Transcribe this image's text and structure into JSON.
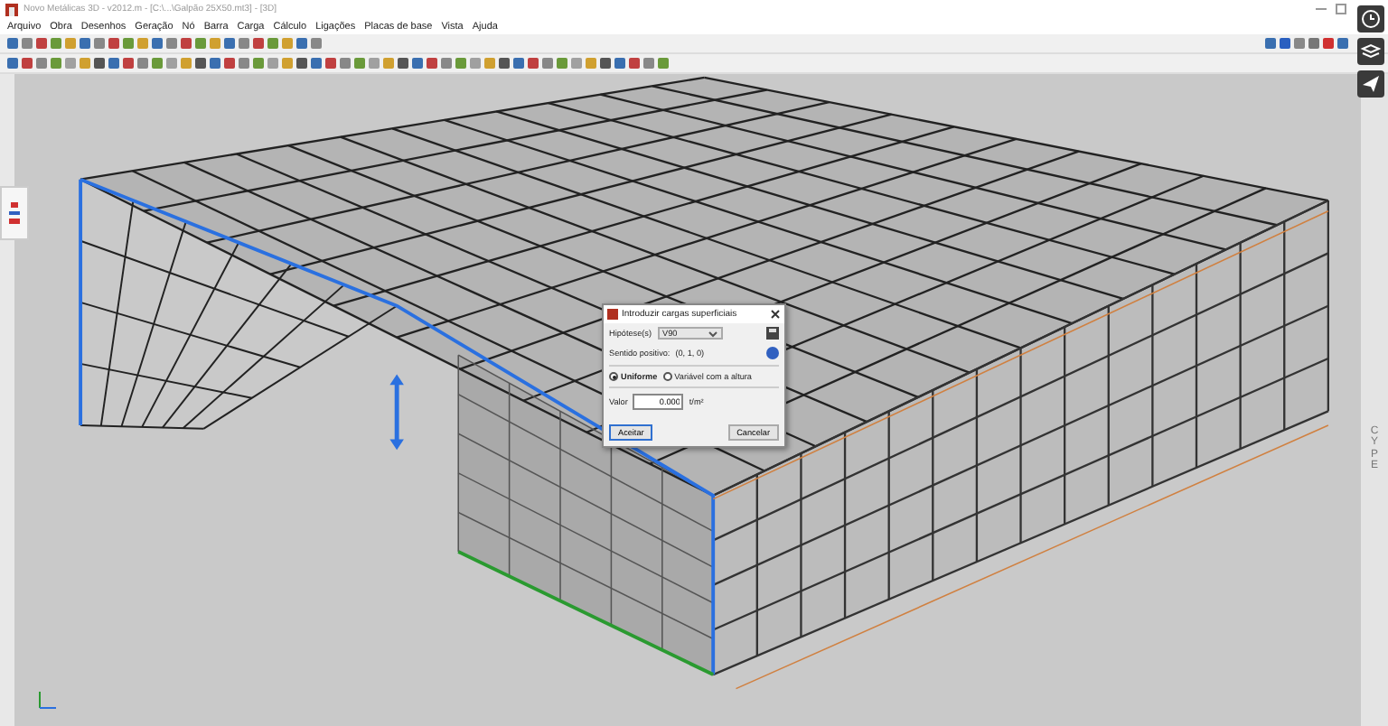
{
  "window": {
    "title": "Novo Metálicas 3D - v2012.m - [C:\\...\\Galpão 25X50.mt3] - [3D]"
  },
  "menu": [
    "Arquivo",
    "Obra",
    "Desenhos",
    "Geração",
    "Nó",
    "Barra",
    "Carga",
    "Cálculo",
    "Ligações",
    "Placas de base",
    "Vista",
    "Ajuda"
  ],
  "dialog": {
    "title": "Introduzir cargas superficiais",
    "hypothesis_label": "Hipótese(s)",
    "hypothesis_value": "V90",
    "direction_label": "Sentido positivo:",
    "direction_value": "(0, 1, 0)",
    "options": [
      {
        "label": "Uniforme",
        "selected": true
      },
      {
        "label": "Variável com a altura",
        "selected": false
      }
    ],
    "value_label": "Valor",
    "value": "0.000",
    "unit": "t/m²",
    "buttons": [
      "Aceitar",
      "Cancelar"
    ]
  },
  "side_label": "CYPE"
}
